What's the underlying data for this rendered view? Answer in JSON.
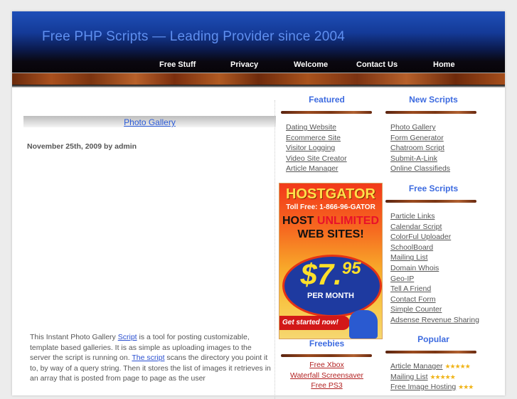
{
  "header": {
    "site_title": "Free PHP Scripts — Leading Provider since 2004",
    "nav": [
      "Free Stuff",
      "Privacy",
      "Welcome",
      "Contact Us",
      "Home"
    ]
  },
  "post": {
    "title": "Photo Gallery",
    "meta": "November 25th, 2009 by admin",
    "body_parts": [
      "This Instant Photo Gallery ",
      "Script",
      " is a tool for posting customizable, template based galleries. It is as simple as uploading images to the server the script is running on. ",
      "The script",
      " scans the directory you point it to, by way of a query string. Then it stores the list of images it retrieves in an array that is posted from page to page as the user"
    ]
  },
  "featured": {
    "heading": "Featured",
    "items": [
      "Dating Website",
      "Ecommerce Site",
      "Visitor Logging",
      "Video Site Creator",
      "Article Manager"
    ]
  },
  "new_scripts": {
    "heading": "New Scripts",
    "items": [
      "Photo Gallery",
      "Form Generator",
      "Chatroom Script",
      "Submit-A-Link",
      "Online Classifieds"
    ]
  },
  "free_scripts": {
    "heading": "Free Scripts",
    "items": [
      "Particle Links",
      "Calendar Script",
      "ColorFul Uploader",
      "SchoolBoard",
      "Mailing List",
      "Domain Whois",
      "Geo-IP",
      "Tell A Friend",
      "Contact Form",
      "Simple Counter",
      "Adsense Revenue Sharing"
    ]
  },
  "freebies": {
    "heading": "Freebies",
    "items": [
      "Free Xbox",
      "Waterfall Screensaver",
      "Free PS3"
    ]
  },
  "popular": {
    "heading": "Popular",
    "items": [
      {
        "label": "Article Manager",
        "stars": "★★★★★",
        "rating": 5
      },
      {
        "label": "Mailing List",
        "stars": "★★★★★",
        "rating": 5
      },
      {
        "label": "Free Image Hosting",
        "stars": "★★★",
        "rating": 3
      }
    ]
  },
  "ad": {
    "brand": "HOSTGATOR",
    "phone": "Toll Free: 1-866-96-GATOR",
    "line1_a": "HOST ",
    "line1_b": "UNLIMITED",
    "line2": "WEB SITES!",
    "price_main": "$7.",
    "price_cents": "95",
    "per_month": "PER MONTH",
    "cta": "Get started now!"
  }
}
